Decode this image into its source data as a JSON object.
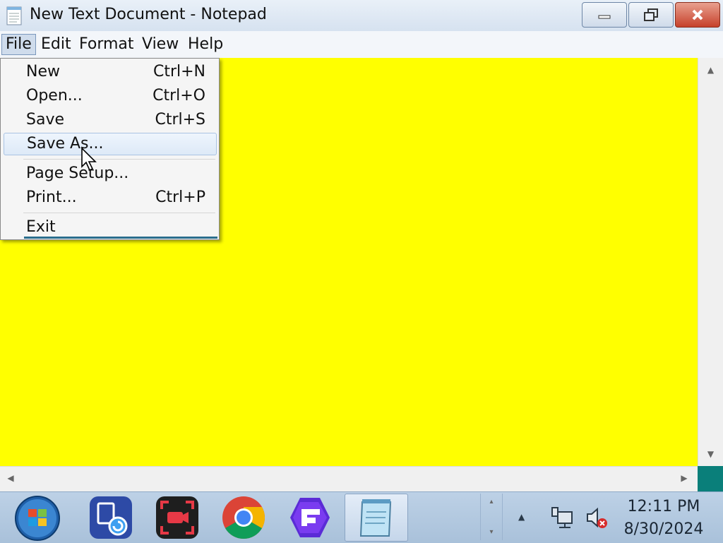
{
  "window": {
    "title": "New Text Document - Notepad",
    "icons": {
      "app": "notepad-icon",
      "minimize": "minimize-icon",
      "maximize": "restore-icon",
      "close": "close-icon"
    }
  },
  "menubar": {
    "items": [
      {
        "label": "File"
      },
      {
        "label": "Edit"
      },
      {
        "label": "Format"
      },
      {
        "label": "View"
      },
      {
        "label": "Help"
      }
    ]
  },
  "file_menu": {
    "items": [
      {
        "label": "New",
        "shortcut": "Ctrl+N"
      },
      {
        "label": "Open...",
        "shortcut": "Ctrl+O"
      },
      {
        "label": "Save",
        "shortcut": "Ctrl+S"
      },
      {
        "label": "Save As...",
        "shortcut": ""
      },
      {
        "label": "Page Setup...",
        "shortcut": ""
      },
      {
        "label": "Print...",
        "shortcut": "Ctrl+P"
      },
      {
        "label": "Exit",
        "shortcut": ""
      }
    ],
    "highlighted": "Save As..."
  },
  "editor": {
    "background": "#ffff00",
    "content": ""
  },
  "taskbar": {
    "apps": [
      {
        "name": "start-orb-icon"
      },
      {
        "name": "backup-restore-app-icon"
      },
      {
        "name": "screen-recorder-app-icon"
      },
      {
        "name": "chrome-icon"
      },
      {
        "name": "f-logo-app-icon"
      },
      {
        "name": "notepad-taskbar-icon"
      }
    ],
    "clock": {
      "time": "12:11 PM",
      "date": "8/30/2024"
    }
  },
  "colors": {
    "accent_corner": "#0a7f7a",
    "close_button": "#c6412b"
  }
}
